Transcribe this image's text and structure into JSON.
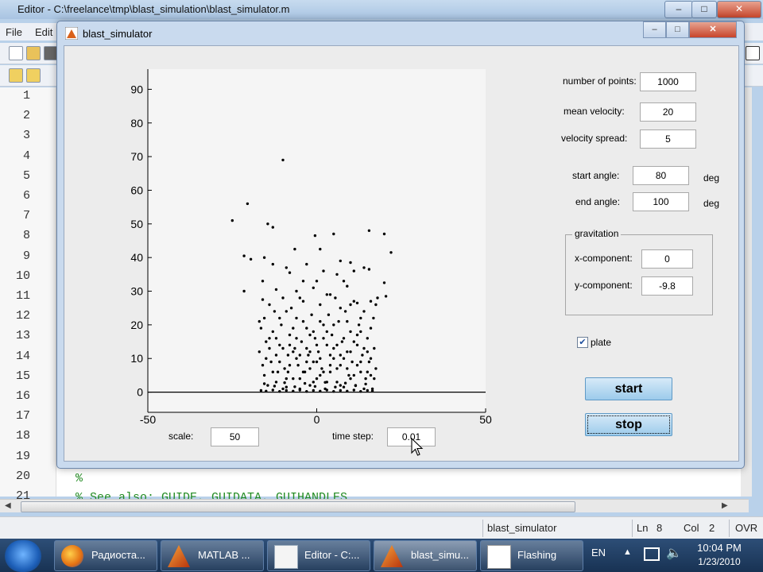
{
  "editor": {
    "title": "Editor - C:\\freelance\\tmp\\blast_simulation\\blast_simulator.m",
    "window_controls": [
      "–",
      "□",
      "✕"
    ],
    "menu": [
      "File",
      "Edit"
    ],
    "line_numbers": [
      "1",
      "2",
      "3",
      "4",
      "5",
      "6",
      "7",
      "8",
      "9",
      "10",
      "11",
      "12",
      "13",
      "14",
      "15",
      "16",
      "17",
      "18",
      "19",
      "20",
      "21"
    ],
    "visible_code": [
      "%",
      "%    See also: GUIDE, GUIDATA, GUIHANDLES"
    ],
    "status": {
      "file": "blast_simulator",
      "ln_label": "Ln",
      "ln": "8",
      "col_label": "Col",
      "col": "2",
      "mode": "OVR"
    }
  },
  "figure": {
    "title": "blast_simulator",
    "window_controls": [
      "–",
      "□",
      "✕"
    ],
    "params": {
      "num_points_label": "number of points:",
      "num_points": "1000",
      "mean_velocity_label": "mean velocity:",
      "mean_velocity": "20",
      "velocity_spread_label": "velocity spread:",
      "velocity_spread": "5",
      "start_angle_label": "start angle:",
      "start_angle": "80",
      "end_angle_label": "end angle:",
      "end_angle": "100",
      "deg_unit": "deg",
      "gravitation_label": "gravitation",
      "gx_label": "x-component:",
      "gx": "0",
      "gy_label": "y-component:",
      "gy": "-9.8",
      "plate_label": "plate",
      "plate_checked": true,
      "start_label": "start",
      "stop_label": "stop",
      "scale_label": "scale:",
      "scale": "50",
      "timestep_label": "time step:",
      "timestep": "0.01"
    }
  },
  "chart_data": {
    "type": "scatter",
    "xlim": [
      -50,
      50
    ],
    "ylim": [
      -6,
      96
    ],
    "x_ticks": [
      "-50",
      "0",
      "50"
    ],
    "y_ticks": [
      "0",
      "10",
      "20",
      "30",
      "40",
      "50",
      "60",
      "70",
      "80",
      "90"
    ],
    "title": "",
    "xlabel": "",
    "ylabel": "",
    "baseline_y": 0,
    "points": [
      [
        -25,
        51
      ],
      [
        -20.5,
        56
      ],
      [
        -21.5,
        40.5
      ],
      [
        -19.5,
        39.5
      ],
      [
        -14.5,
        50
      ],
      [
        -13,
        49
      ],
      [
        -10,
        69
      ],
      [
        -15.5,
        40
      ],
      [
        -21.5,
        30
      ],
      [
        -6.5,
        42.5
      ],
      [
        -0.5,
        46.5
      ],
      [
        1,
        42.5
      ],
      [
        5,
        47
      ],
      [
        7,
        39
      ],
      [
        10,
        38.5
      ],
      [
        15.5,
        48
      ],
      [
        20,
        47
      ],
      [
        22,
        41.5
      ],
      [
        15.5,
        36.5
      ],
      [
        14,
        37
      ],
      [
        -16,
        33
      ],
      [
        -12,
        30.5
      ],
      [
        -8,
        35.5
      ],
      [
        -4,
        33
      ],
      [
        -1,
        31
      ],
      [
        3,
        29
      ],
      [
        6,
        35
      ],
      [
        9,
        31.5
      ],
      [
        12,
        26.5
      ],
      [
        18,
        28
      ],
      [
        20.5,
        28.5
      ],
      [
        20,
        32.5
      ],
      [
        -16,
        27.5
      ],
      [
        -10,
        28
      ],
      [
        -17,
        12
      ],
      [
        -16.5,
        19
      ],
      [
        -15.5,
        5
      ],
      [
        -15.5,
        22
      ],
      [
        -14,
        16
      ],
      [
        -13.5,
        9
      ],
      [
        -12.5,
        24
      ],
      [
        -12,
        3
      ],
      [
        -11,
        14
      ],
      [
        -10.5,
        20
      ],
      [
        -9.5,
        7
      ],
      [
        -9,
        1.5
      ],
      [
        -8.5,
        11
      ],
      [
        -8,
        17
      ],
      [
        -7.5,
        25
      ],
      [
        -7,
        4
      ],
      [
        -6.5,
        13
      ],
      [
        -6,
        22
      ],
      [
        -5.5,
        8
      ],
      [
        -5,
        1
      ],
      [
        -4.5,
        15
      ],
      [
        -4,
        27
      ],
      [
        -3.5,
        6
      ],
      [
        -3,
        19
      ],
      [
        -2.5,
        11
      ],
      [
        -2,
        2
      ],
      [
        -1.5,
        23
      ],
      [
        -1,
        9
      ],
      [
        -0.5,
        16
      ],
      [
        0,
        4
      ],
      [
        0.5,
        12
      ],
      [
        1,
        26
      ],
      [
        1.5,
        7
      ],
      [
        2,
        20
      ],
      [
        2.5,
        1
      ],
      [
        3,
        14
      ],
      [
        3.5,
        23
      ],
      [
        4,
        6
      ],
      [
        4.5,
        17
      ],
      [
        5,
        10
      ],
      [
        5.5,
        28
      ],
      [
        6,
        3
      ],
      [
        6.5,
        21
      ],
      [
        7,
        8
      ],
      [
        7.5,
        15
      ],
      [
        8,
        1.5
      ],
      [
        8.5,
        24
      ],
      [
        9,
        12
      ],
      [
        9.5,
        5
      ],
      [
        10,
        18
      ],
      [
        10.5,
        9
      ],
      [
        11,
        27
      ],
      [
        11.5,
        2
      ],
      [
        12,
        14
      ],
      [
        12.5,
        20
      ],
      [
        13,
        6
      ],
      [
        13.5,
        11
      ],
      [
        14,
        24
      ],
      [
        14.5,
        4
      ],
      [
        15,
        16
      ],
      [
        15.5,
        9
      ],
      [
        16,
        19
      ],
      [
        16.5,
        1
      ],
      [
        17,
        13
      ],
      [
        17.5,
        7
      ],
      [
        16.8,
        22
      ],
      [
        -16,
        8
      ],
      [
        -15,
        15
      ],
      [
        -14.5,
        2
      ],
      [
        -13,
        18
      ],
      [
        -12,
        11
      ],
      [
        -11.5,
        6
      ],
      [
        -10,
        1
      ],
      [
        -9,
        24
      ],
      [
        -8.5,
        6
      ],
      [
        -7,
        19
      ],
      [
        -6,
        10
      ],
      [
        -5,
        4
      ],
      [
        -4,
        21
      ],
      [
        -3,
        13
      ],
      [
        -2,
        7
      ],
      [
        -1,
        18
      ],
      [
        0,
        9
      ],
      [
        1,
        5
      ],
      [
        2,
        16
      ],
      [
        3,
        3
      ],
      [
        4,
        11
      ],
      [
        5,
        20
      ],
      [
        6,
        14
      ],
      [
        7,
        2
      ],
      [
        8,
        10
      ],
      [
        9,
        21
      ],
      [
        10,
        4
      ],
      [
        11,
        15
      ],
      [
        12,
        8
      ],
      [
        13,
        22
      ],
      [
        14,
        1
      ],
      [
        15,
        12
      ],
      [
        16,
        5
      ],
      [
        -14,
        26
      ],
      [
        -11,
        22
      ],
      [
        -8,
        14
      ],
      [
        -5,
        28
      ],
      [
        -2,
        17
      ],
      [
        1,
        21
      ],
      [
        4,
        29
      ],
      [
        7,
        25
      ],
      [
        10,
        26
      ],
      [
        13,
        18
      ],
      [
        16,
        27
      ],
      [
        -16.5,
        0.5
      ],
      [
        -15,
        0.3
      ],
      [
        -13,
        0.6
      ],
      [
        -11,
        0.2
      ],
      [
        -9,
        0.5
      ],
      [
        -7,
        0.3
      ],
      [
        -5,
        0.6
      ],
      [
        -3,
        0.2
      ],
      [
        -1,
        0.5
      ],
      [
        1,
        0.3
      ],
      [
        3,
        0.6
      ],
      [
        5,
        0.2
      ],
      [
        7,
        0.5
      ],
      [
        9,
        0.3
      ],
      [
        11,
        0.6
      ],
      [
        13,
        0.2
      ],
      [
        15,
        0.5
      ],
      [
        16.5,
        0.4
      ],
      [
        -15.5,
        2.5
      ],
      [
        -12.5,
        1.8
      ],
      [
        -9.5,
        2.8
      ],
      [
        -6.5,
        1.6
      ],
      [
        -3.5,
        2.6
      ],
      [
        -0.5,
        1.7
      ],
      [
        2.5,
        2.9
      ],
      [
        5.5,
        1.5
      ],
      [
        8.5,
        2.7
      ],
      [
        11.5,
        1.9
      ],
      [
        14.5,
        2.4
      ],
      [
        -15,
        10
      ],
      [
        -14,
        13
      ],
      [
        -13,
        6
      ],
      [
        -12,
        16
      ],
      [
        -11,
        9
      ],
      [
        -10,
        13
      ],
      [
        -9,
        4
      ],
      [
        -8,
        8
      ],
      [
        -7,
        12
      ],
      [
        -6,
        16
      ],
      [
        -5,
        11
      ],
      [
        -4,
        6
      ],
      [
        -3,
        9
      ],
      [
        -2,
        12
      ],
      [
        -1,
        3
      ],
      [
        0,
        14
      ],
      [
        1,
        10
      ],
      [
        2,
        6
      ],
      [
        3,
        18
      ],
      [
        4,
        8
      ],
      [
        5,
        13
      ],
      [
        6,
        7
      ],
      [
        7,
        11
      ],
      [
        8,
        16
      ],
      [
        9,
        7
      ],
      [
        10,
        12
      ],
      [
        11,
        5
      ],
      [
        12,
        17
      ],
      [
        13,
        9
      ],
      [
        14,
        13
      ],
      [
        15,
        6
      ],
      [
        16,
        10
      ],
      [
        17,
        4
      ],
      [
        -13,
        38
      ],
      [
        -9,
        37
      ],
      [
        -3,
        38
      ],
      [
        2,
        36
      ],
      [
        8,
        33
      ],
      [
        11,
        36
      ],
      [
        -17,
        21
      ],
      [
        17.5,
        26
      ],
      [
        -6,
        30
      ],
      [
        0,
        33
      ]
    ]
  }
}
